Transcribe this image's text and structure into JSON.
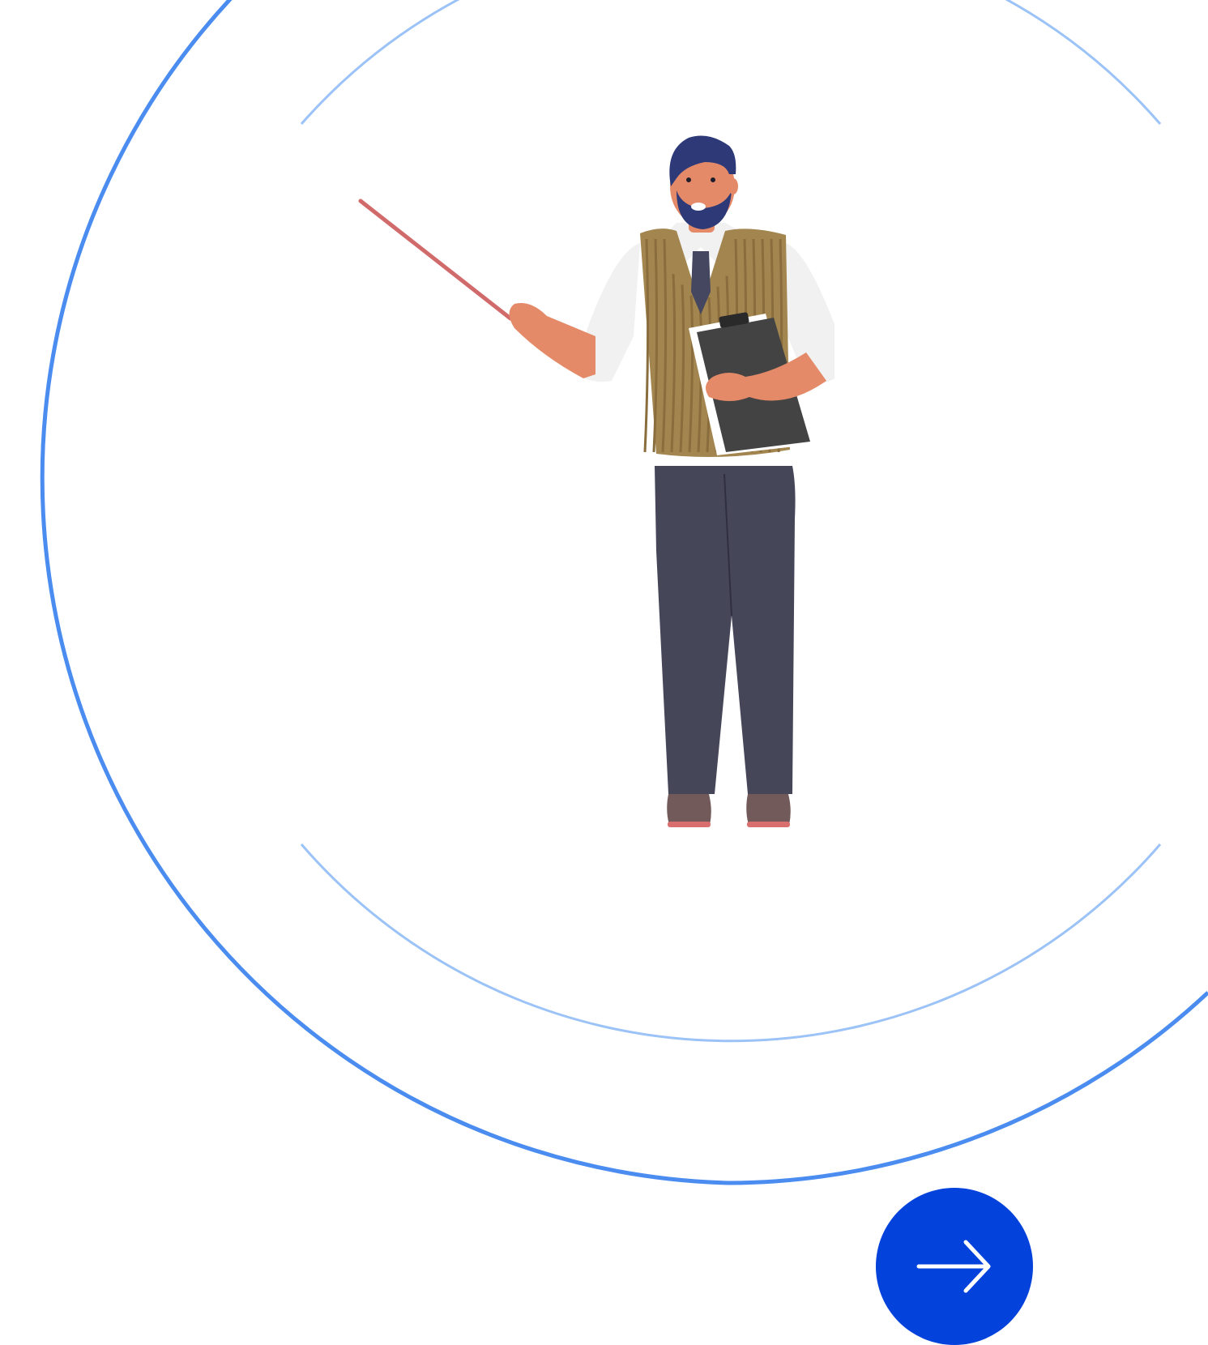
{
  "colors": {
    "background": "#ffffff",
    "ring_outer": "#4a8cf0",
    "ring_inner": "#9cc3f7",
    "button_fill": "#0442dc",
    "button_icon": "#ffffff",
    "skin": "#e48a68",
    "hair": "#2e3a78",
    "shirt": "#f1f1f1",
    "vest": "#a3854f",
    "vest_stripe": "#8a6d3c",
    "tie": "#44475f",
    "trousers": "#464659",
    "clipboard": "#434343",
    "shoes": "#735a5a",
    "shoe_sole": "#d96e6e",
    "pointer": "#d16a6a"
  },
  "illustration": {
    "subject": "teacher-with-pointer-and-clipboard",
    "icon": "teacher-illustration"
  },
  "navigation": {
    "next_icon": "arrow-right-icon"
  }
}
